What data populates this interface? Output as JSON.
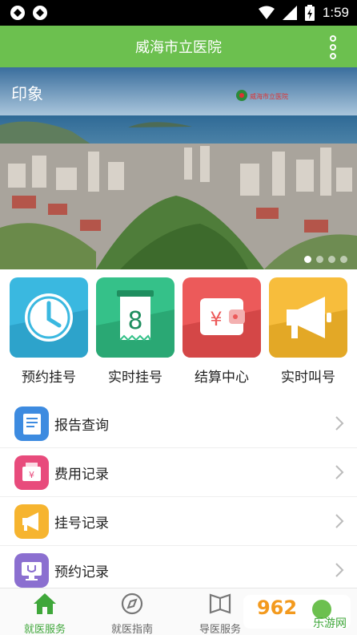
{
  "status_bar": {
    "time": "1:59"
  },
  "app_bar": {
    "title": "威海市立医院"
  },
  "banner": {
    "caption_text": "印象",
    "logo_text": "威海市立医院",
    "dot_count": 4,
    "active_dot": 0
  },
  "quick_actions": [
    {
      "label": "预约挂号",
      "icon": "clock-icon",
      "color": "#3ab8e0"
    },
    {
      "label": "实时挂号",
      "icon": "number-ticket-icon",
      "icon_text": "8",
      "color": "#35c189"
    },
    {
      "label": "结算中心",
      "icon": "wallet-yen-icon",
      "icon_text": "¥",
      "color": "#ec5a5a"
    },
    {
      "label": "实时叫号",
      "icon": "megaphone-icon",
      "color": "#f7bd3c"
    }
  ],
  "menu": [
    {
      "label": "报告查询",
      "icon": "report-icon",
      "color": "#3d8be0"
    },
    {
      "label": "费用记录",
      "icon": "fee-record-icon",
      "color": "#e84b7c"
    },
    {
      "label": "挂号记录",
      "icon": "register-record-icon",
      "color": "#f6b42f"
    },
    {
      "label": "预约记录",
      "icon": "appointment-record-icon",
      "color": "#8b6fd0"
    }
  ],
  "bottom_nav": [
    {
      "label": "就医服务",
      "icon": "home-icon",
      "active": true
    },
    {
      "label": "就医指南",
      "icon": "compass-icon",
      "active": false
    },
    {
      "label": "导医服务",
      "icon": "map-book-icon",
      "active": false
    }
  ],
  "watermark": {
    "text_top": "962",
    "text_bottom": "乐游网"
  },
  "colors": {
    "primary": "#6cc04f",
    "nav_active": "#3fa73a"
  }
}
